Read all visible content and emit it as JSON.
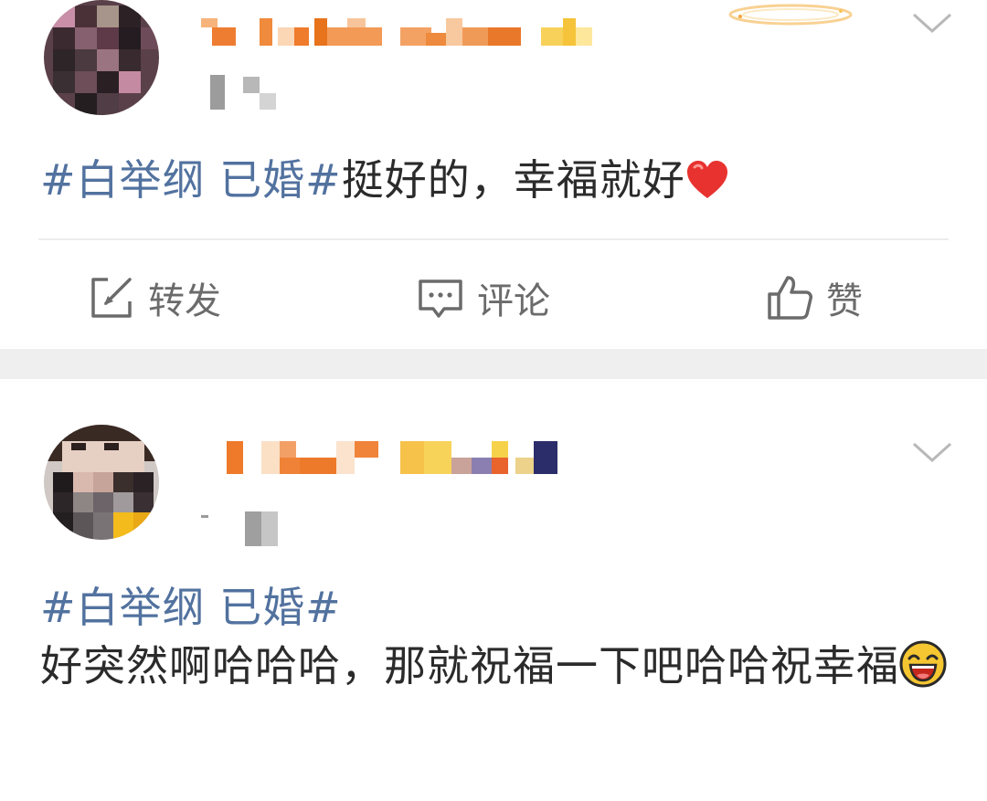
{
  "posts": [
    {
      "topic": "#白举纲 已婚#",
      "body": "挺好的，幸福就好",
      "emoji": "heart-icon",
      "actions": {
        "repost": "转发",
        "comment": "评论",
        "like": "赞"
      }
    },
    {
      "topic": "#白举纲 已婚#",
      "body": "好突然啊哈哈哈，那就祝福一下吧哈哈祝幸福",
      "emoji": "laughing-face-icon"
    }
  ],
  "colors": {
    "topic": "#52729f",
    "body_text": "#2b2b2b",
    "action_text": "#6b6b6b",
    "separator": "#efefef",
    "divider": "#ececec",
    "heart": "#e8322f"
  },
  "icons": {
    "more": "chevron-down-icon",
    "repost": "repost-icon",
    "comment": "comment-icon",
    "like": "thumbs-up-icon"
  }
}
